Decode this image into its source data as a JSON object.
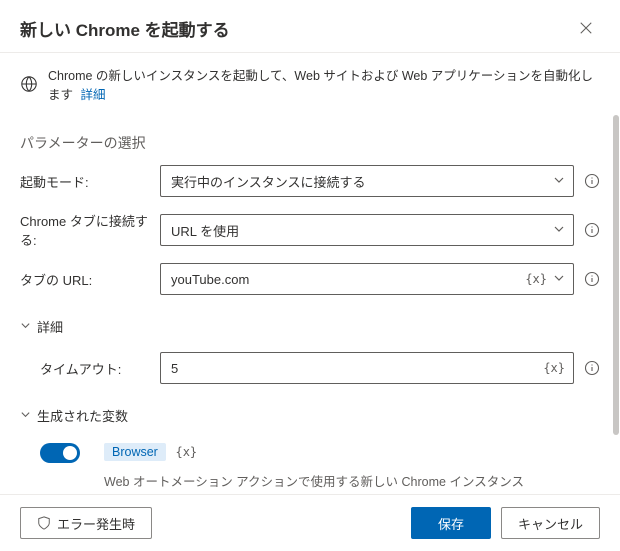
{
  "dialog": {
    "title": "新しい Chrome を起動する",
    "banner_text": "Chrome の新しいインスタンスを起動して、Web サイトおよび Web アプリケーションを自動化します",
    "banner_link": "詳細"
  },
  "section": {
    "parameters_title": "パラメーターの選択",
    "launch_mode_label": "起動モード:",
    "launch_mode_value": "実行中のインスタンスに接続する",
    "connect_tab_label": "Chrome タブに接続する:",
    "connect_tab_value": "URL を使用",
    "tab_url_label": "タブの URL:",
    "tab_url_value": "youTube.com",
    "advanced_label": "詳細",
    "timeout_label": "タイムアウト:",
    "timeout_value": "5",
    "generated_vars_label": "生成された変数",
    "var_name": "Browser",
    "var_token": "{x}",
    "var_desc": "Web オートメーション アクションで使用する新しい Chrome インスタンス",
    "expr_token": "{x}"
  },
  "footer": {
    "on_error": "エラー発生時",
    "save": "保存",
    "cancel": "キャンセル"
  }
}
